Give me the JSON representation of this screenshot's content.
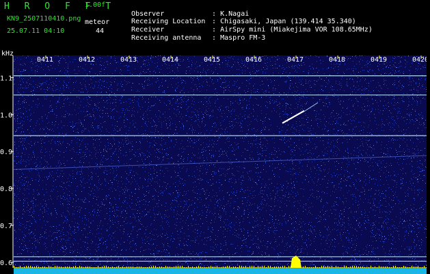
{
  "header": {
    "title": "H R O F F T",
    "version": "1.00f",
    "filename": "KN9_2507110410.png",
    "meteor_label": "meteor",
    "datetime": "25.07.11 04:10",
    "count": "44"
  },
  "meta": [
    {
      "key": "Observer",
      "sep": ": ",
      "value": "K.Nagai"
    },
    {
      "key": "Receiving Location",
      "sep": ": ",
      "value": "Chigasaki, Japan (139.414 35.340)"
    },
    {
      "key": "Receiver",
      "sep": ": ",
      "value": "AirSpy mini (Miakejima VOR 108.65MHz)"
    },
    {
      "key": "Receiving antenna",
      "sep": ": ",
      "value": "Maspro FM-3"
    }
  ],
  "chart_data": {
    "type": "heatmap",
    "ylabel": "kHz",
    "ylim": [
      0.585,
      1.16
    ],
    "y_ticks": [
      "0.6",
      "0.7",
      "0.8",
      "0.9",
      "1.0",
      "1.1"
    ],
    "x_ticks": [
      "0411",
      "0412",
      "0413",
      "0414",
      "0415",
      "0416",
      "0417",
      "0418",
      "0419",
      "0420"
    ],
    "colors": {
      "background": "#0a0a50",
      "noise": "#2a4cd8",
      "signal": "#bfe8ff",
      "meteor": "#ffffff",
      "ruler": "#ffff00",
      "baseline": "#19b6e6"
    },
    "horizontal_lines_khz": [
      1.105,
      1.053,
      0.943,
      0.615,
      0.603
    ],
    "meteor_echo": {
      "time": "0417",
      "khz": 0.999
    }
  }
}
